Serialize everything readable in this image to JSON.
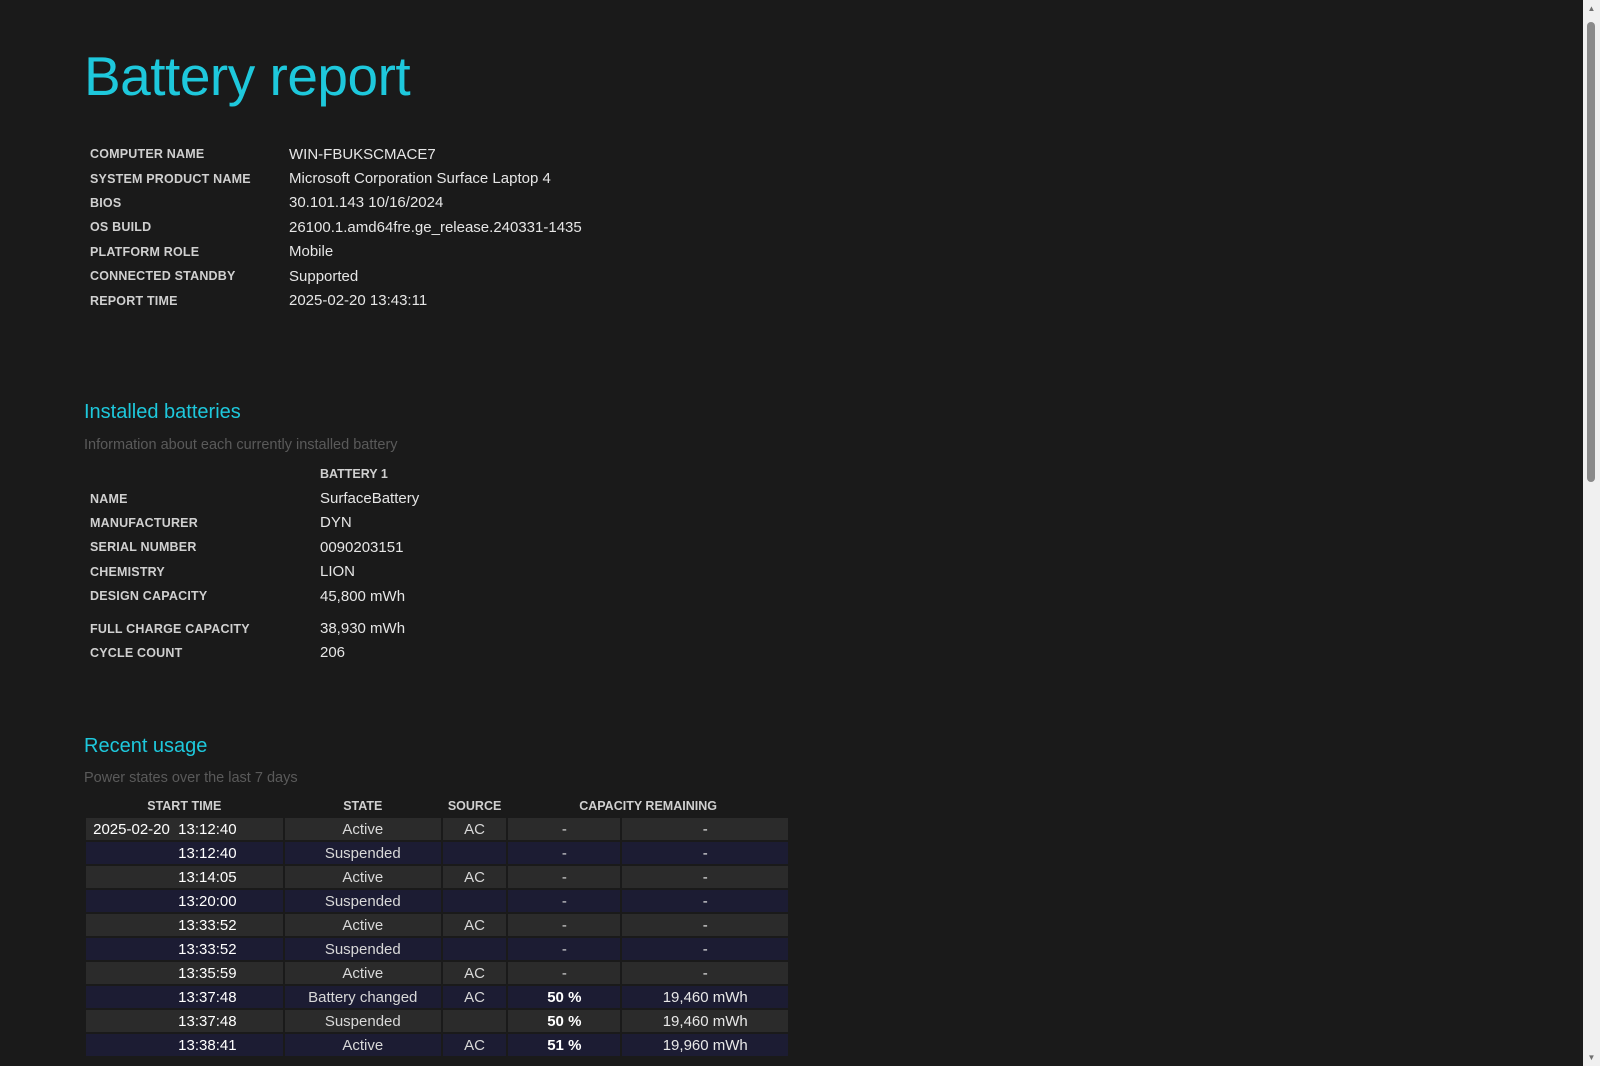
{
  "title": "Battery report",
  "system_info": [
    {
      "label": "COMPUTER NAME",
      "value": "WIN-FBUKSCMACE7"
    },
    {
      "label": "SYSTEM PRODUCT NAME",
      "value": "Microsoft Corporation Surface Laptop 4"
    },
    {
      "label": "BIOS",
      "value": "30.101.143 10/16/2024"
    },
    {
      "label": "OS BUILD",
      "value": "26100.1.amd64fre.ge_release.240331-1435"
    },
    {
      "label": "PLATFORM ROLE",
      "value": "Mobile"
    },
    {
      "label": "CONNECTED STANDBY",
      "value": "Supported"
    },
    {
      "label": "REPORT TIME",
      "value": "2025-02-20  13:43:11"
    }
  ],
  "installed_batteries": {
    "heading": "Installed batteries",
    "subtitle": "Information about each currently installed battery",
    "column_header": "BATTERY 1",
    "rows": [
      {
        "label": "NAME",
        "value": "SurfaceBattery"
      },
      {
        "label": "MANUFACTURER",
        "value": "DYN"
      },
      {
        "label": "SERIAL NUMBER",
        "value": "0090203151"
      },
      {
        "label": "CHEMISTRY",
        "value": "LION"
      },
      {
        "label": "DESIGN CAPACITY",
        "value": "45,800 mWh"
      },
      {
        "label": "FULL CHARGE CAPACITY",
        "value": "38,930 mWh"
      },
      {
        "label": "CYCLE COUNT",
        "value": "206"
      }
    ]
  },
  "recent_usage": {
    "heading": "Recent usage",
    "subtitle": "Power states over the last 7 days",
    "columns": {
      "start_time": "START TIME",
      "state": "STATE",
      "source": "SOURCE",
      "capacity": "CAPACITY REMAINING"
    },
    "rows": [
      {
        "time": "2025-02-20  13:12:40",
        "state": "Active",
        "source": "AC",
        "pct": "-",
        "cap": "-"
      },
      {
        "time": "13:12:40",
        "state": "Suspended",
        "source": "",
        "pct": "-",
        "cap": "-"
      },
      {
        "time": "13:14:05",
        "state": "Active",
        "source": "AC",
        "pct": "-",
        "cap": "-"
      },
      {
        "time": "13:20:00",
        "state": "Suspended",
        "source": "",
        "pct": "-",
        "cap": "-"
      },
      {
        "time": "13:33:52",
        "state": "Active",
        "source": "AC",
        "pct": "-",
        "cap": "-"
      },
      {
        "time": "13:33:52",
        "state": "Suspended",
        "source": "",
        "pct": "-",
        "cap": "-"
      },
      {
        "time": "13:35:59",
        "state": "Active",
        "source": "AC",
        "pct": "-",
        "cap": "-"
      },
      {
        "time": "13:37:48",
        "state": "Battery changed",
        "source": "AC",
        "pct": "50 %",
        "cap": "19,460 mWh"
      },
      {
        "time": "13:37:48",
        "state": "Suspended",
        "source": "",
        "pct": "50 %",
        "cap": "19,460 mWh"
      },
      {
        "time": "13:38:41",
        "state": "Active",
        "source": "AC",
        "pct": "51 %",
        "cap": "19,960 mWh"
      }
    ]
  }
}
